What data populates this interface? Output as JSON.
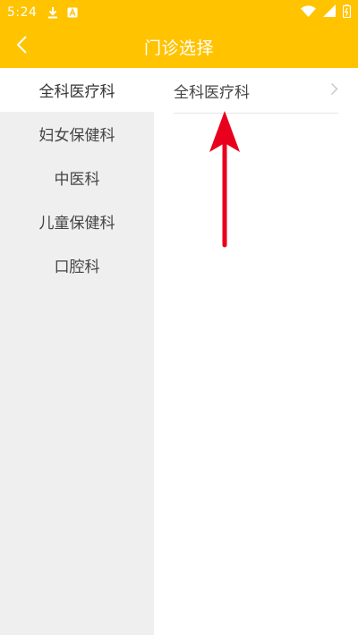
{
  "status_bar": {
    "time": "5:24",
    "icons_left": [
      "download-icon",
      "app-notification-icon"
    ],
    "icons_right": [
      "wifi-icon",
      "signal-icon",
      "battery-icon"
    ]
  },
  "header": {
    "title": "门诊选择",
    "back_icon": "chevron-left-icon",
    "bg_color": "#ffc300"
  },
  "sidebar": {
    "items": [
      {
        "label": "全科医疗科",
        "active": true
      },
      {
        "label": "妇女保健科",
        "active": false
      },
      {
        "label": "中医科",
        "active": false
      },
      {
        "label": "儿童保健科",
        "active": false
      },
      {
        "label": "口腔科",
        "active": false
      }
    ]
  },
  "content": {
    "departments": [
      {
        "label": "全科医疗科",
        "icon": "chevron-right-icon"
      }
    ]
  },
  "annotation": {
    "arrow_color": "#e8001c"
  }
}
